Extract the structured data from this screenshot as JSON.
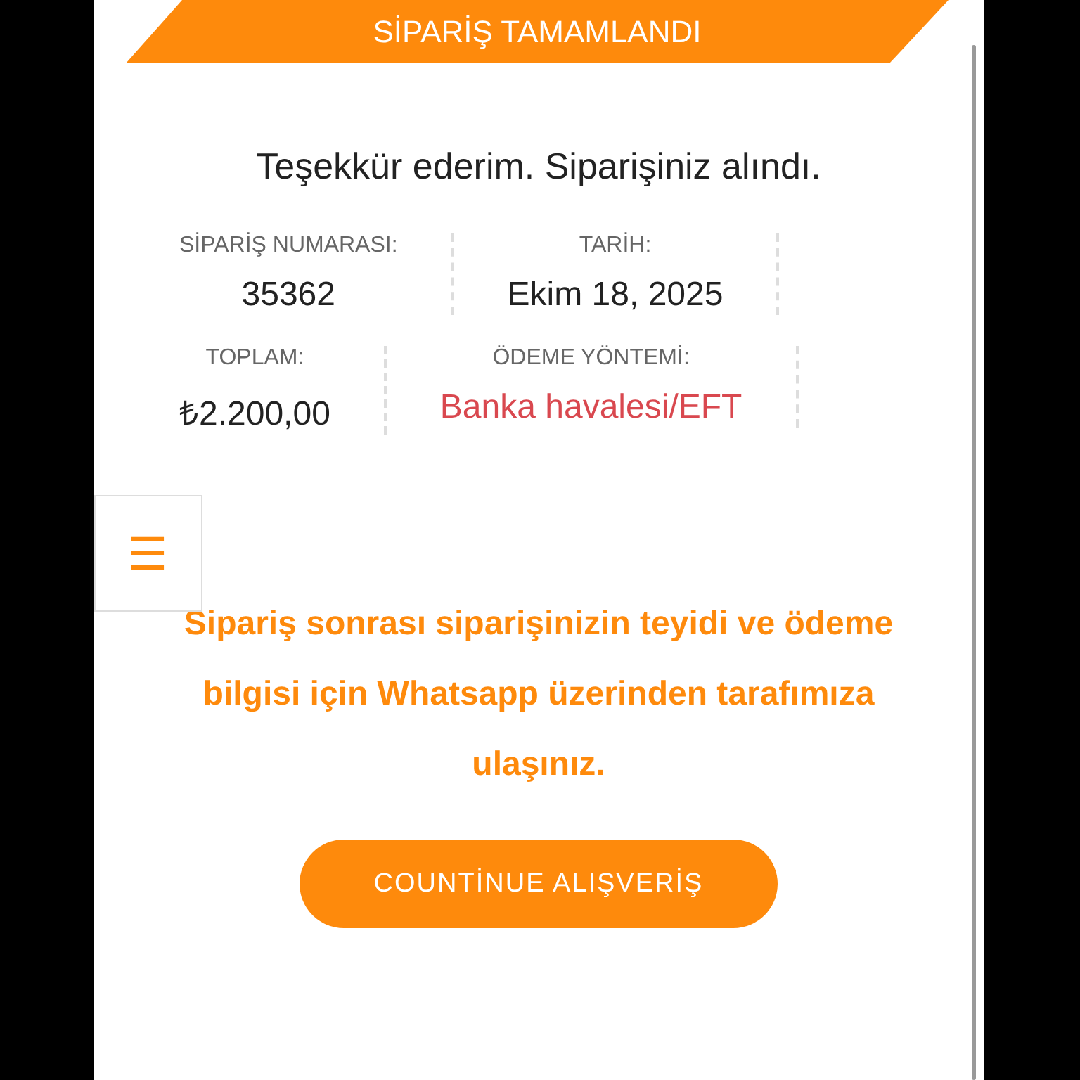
{
  "banner": {
    "title": "SİPARİŞ TAMAMLANDI"
  },
  "thanks": "Teşekkür ederim. Siparişiniz alındı.",
  "details": [
    {
      "kind": "plain",
      "label": "SİPARİŞ NUMARASI:",
      "value": "35362"
    },
    {
      "kind": "plain",
      "label": "TARİH:",
      "value": "Ekim 18, 2025"
    },
    {
      "kind": "plain",
      "label": "TOPLAM:",
      "value": "₺2.200,00"
    },
    {
      "kind": "highlight",
      "label": "ÖDEME YÖNTEMİ:",
      "value": "Banka havalesi/EFT"
    }
  ],
  "menu_button": {
    "icon": "☰"
  },
  "notice": "Sipariş sonrası siparişinizin teyidi ve ödeme bilgisi için Whatsapp üzerinden tarafımıza ulaşınız.",
  "continue_button": "COUNTİNUE ALIŞVERİŞ"
}
